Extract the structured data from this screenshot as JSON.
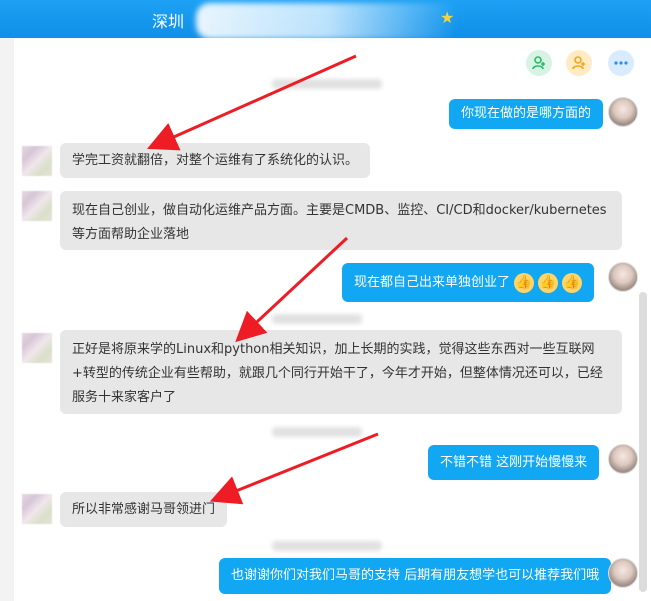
{
  "header": {
    "title": "深圳"
  },
  "toolbar": {
    "add_friend_icon": "add-person-icon",
    "group_icon": "group-icon",
    "more_icon": "more-icon"
  },
  "messages": [
    {
      "side": "right",
      "text": "你现在做的是哪方面的"
    },
    {
      "side": "left",
      "text": "学完工资就翻倍，对整个运维有了系统化的认识。"
    },
    {
      "side": "left",
      "text": "现在自己创业，做自动化运维产品方面。主要是CMDB、监控、CI/CD和docker/kubernetes等方面帮助企业落地"
    },
    {
      "side": "right",
      "text": "现在都自己出来单独创业了"
    },
    {
      "side": "left",
      "text": "正好是将原来学的Linux和python相关知识，加上长期的实践，觉得这些东西对一些互联网+转型的传统企业有些帮助，就跟几个同行开始干了，今年才开始，但整体情况还可以，已经服务十来家客户了"
    },
    {
      "side": "right",
      "text": "不错不错 这刚开始慢慢来"
    },
    {
      "side": "left",
      "text": "所以非常感谢马哥领进门"
    },
    {
      "side": "right",
      "text": "也谢谢你们对我们马哥的支持 后期有朋友想学也可以推荐我们哦"
    }
  ],
  "colors": {
    "header": "#1296ea",
    "right_bubble": "#12a7f2",
    "left_bubble": "#e7e7e7",
    "arrow": "#ee1c24"
  }
}
